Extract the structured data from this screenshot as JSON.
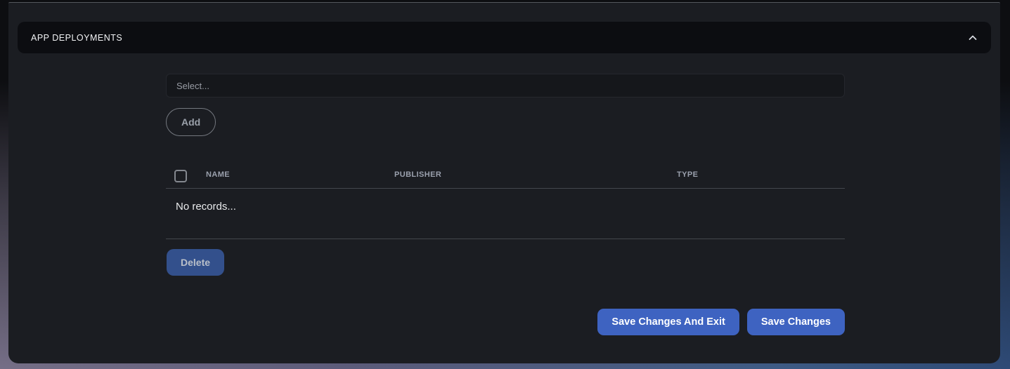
{
  "panel": {
    "header": {
      "title": "APP DEPLOYMENTS",
      "collapse_icon": "chevron-up-icon"
    },
    "select": {
      "placeholder": "Select...",
      "value": ""
    },
    "add_button": {
      "label": "Add"
    },
    "table": {
      "columns": [
        "NAME",
        "PUBLISHER",
        "TYPE"
      ],
      "select_all_checkbox": {
        "checked": false
      },
      "rows": [],
      "empty_text": "No records..."
    },
    "delete_button": {
      "label": "Delete"
    },
    "footer": {
      "save_exit_button": {
        "label": "Save Changes And Exit"
      },
      "save_button": {
        "label": "Save Changes"
      }
    }
  },
  "colors": {
    "accent": "#3e63c1",
    "delete_bg": "#33508c",
    "panel_bg": "#1b1d22",
    "card_bg": "#0c0d11"
  }
}
